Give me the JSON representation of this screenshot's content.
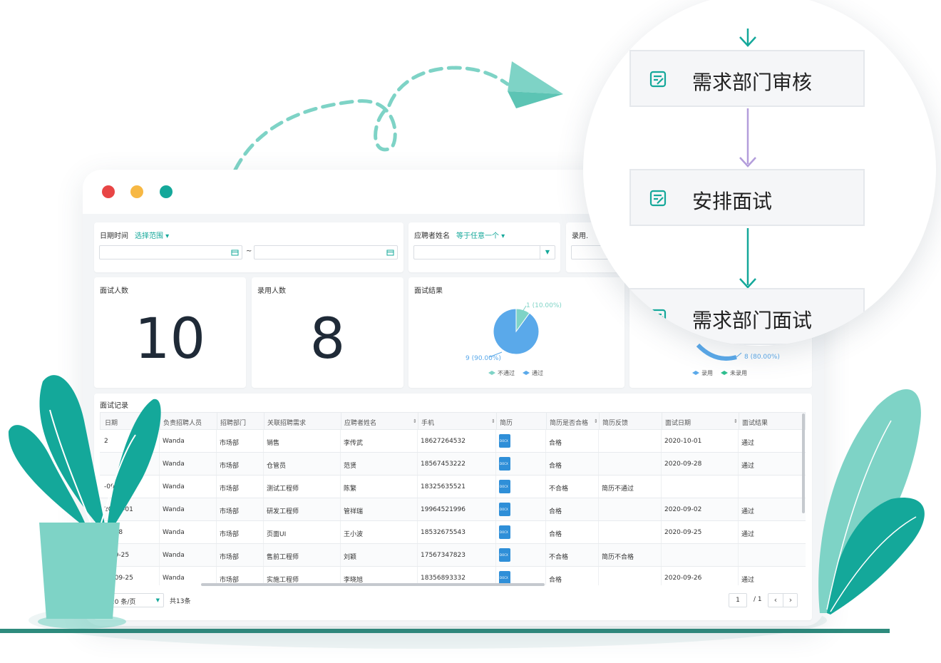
{
  "window": {
    "controls": [
      "close",
      "minimize",
      "maximize"
    ]
  },
  "filters": {
    "date_label": "日期时间",
    "date_mode": "选择范围",
    "date_from": "",
    "date_to": "",
    "date_sep": "~",
    "name_label": "应聘者姓名",
    "name_mode": "等于任意一个",
    "name_value": "",
    "hire_label": "录用.",
    "hire_value": ""
  },
  "stats": {
    "interview_label": "面试人数",
    "interview_count": "10",
    "hire_label": "录用人数",
    "hire_count": "8"
  },
  "result_chart_title": "面试结果",
  "chart_data": [
    {
      "type": "pie",
      "title": "面试结果",
      "categories": [
        "不通过",
        "通过"
      ],
      "values": [
        1,
        9
      ],
      "data_labels": [
        "1 (10.00%)",
        "9 (90.00%)"
      ],
      "colors": [
        "#7ed3c6",
        "#5aa9ea"
      ],
      "legend": "bottom"
    },
    {
      "type": "pie",
      "categories": [
        "录用",
        "未录用"
      ],
      "data_labels": [
        "8 (80.00%)"
      ],
      "colors": [
        "#5aa9ea",
        "#2fbf8f"
      ],
      "legend": "bottom"
    }
  ],
  "records": {
    "title": "面试记录",
    "columns": [
      "日期",
      "负责招聘人员",
      "招聘部门",
      "关联招聘需求",
      "应聘者姓名",
      "手机",
      "简历",
      "简历是否合格",
      "简历反馈",
      "面试日期",
      "面试结果"
    ],
    "rows": [
      [
        "2",
        "Wanda",
        "市场部",
        "销售",
        "李传武",
        "18627264532",
        "docx",
        "合格",
        "",
        "2020-10-01",
        "通过"
      ],
      [
        "",
        "Wanda",
        "市场部",
        "仓管员",
        "范贤",
        "18567453222",
        "docx",
        "合格",
        "",
        "2020-09-28",
        "通过"
      ],
      [
        "-09-25",
        "Wanda",
        "市场部",
        "测试工程师",
        "陈繁",
        "18325635521",
        "docx",
        "不合格",
        "简历不通过",
        "",
        ""
      ],
      [
        "20-09-01",
        "Wanda",
        "市场部",
        "研发工程师",
        "管祥瑞",
        "19964521996",
        "docx",
        "合格",
        "",
        "2020-09-02",
        "通过"
      ],
      [
        "08-28",
        "Wanda",
        "市场部",
        "页面UI",
        "王小波",
        "18532675543",
        "docx",
        "合格",
        "",
        "2020-09-25",
        "通过"
      ],
      [
        "0-09-25",
        "Wanda",
        "市场部",
        "售前工程师",
        "刘颖",
        "17567347823",
        "docx",
        "不合格",
        "简历不合格",
        "",
        ""
      ],
      [
        "20-09-25",
        "Wanda",
        "市场部",
        "实施工程师",
        "李晓旭",
        "18356893332",
        "docx",
        "合格",
        "",
        "2020-09-26",
        "通过"
      ]
    ],
    "page_size": "20 条/页",
    "total": "共13条",
    "current_page": "1",
    "page_total": "/ 1"
  },
  "flow": {
    "steps": [
      "需求部门审核",
      "安排面试",
      "需求部门面试"
    ],
    "arrow_colors": [
      "#14a89a",
      "#b39ddb",
      "#14a89a"
    ]
  },
  "colors": {
    "accent": "#14a89a",
    "link": "#2f8fd8",
    "close": "#e84545",
    "minimize": "#f7b844",
    "maximize": "#14a89a"
  }
}
